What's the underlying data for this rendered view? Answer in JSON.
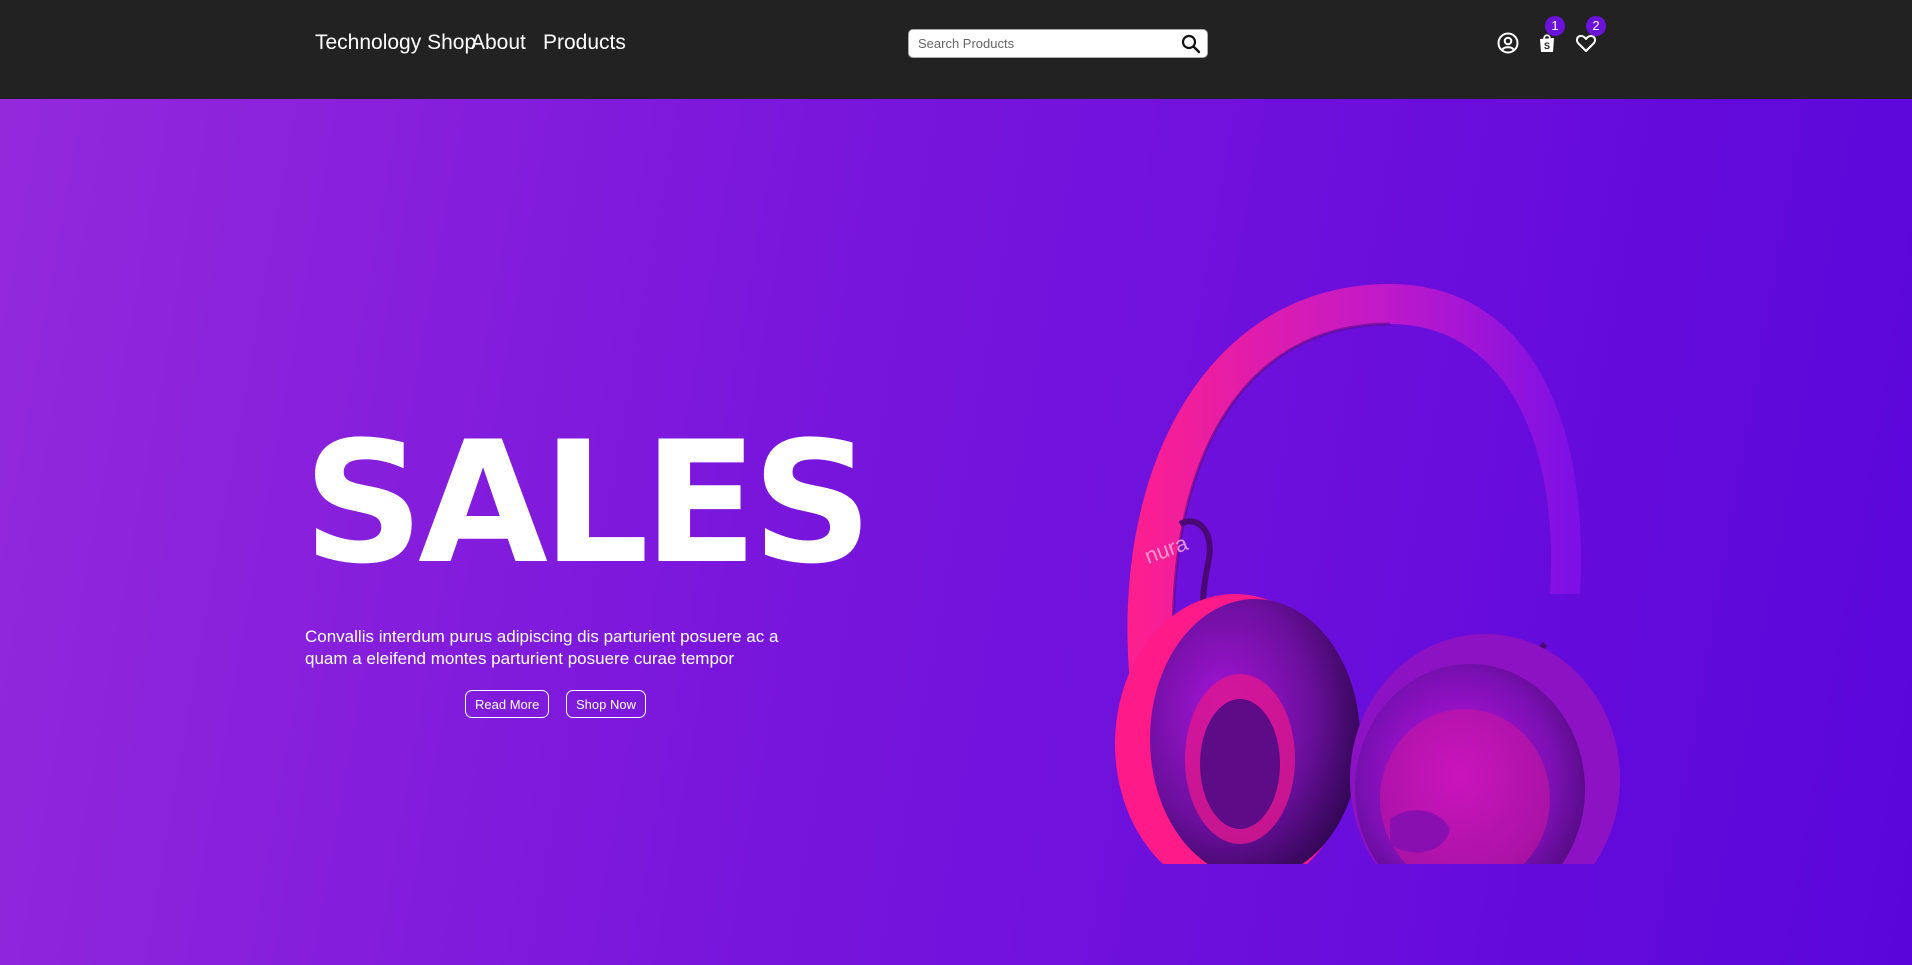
{
  "header": {
    "brand": "Technology Shop",
    "nav": [
      {
        "label": "About"
      },
      {
        "label": "Products"
      }
    ],
    "search": {
      "placeholder": "Search Products",
      "value": "",
      "icon": "search-icon"
    },
    "icons": [
      {
        "name": "user-icon"
      },
      {
        "name": "shopping-bag-icon",
        "badge": "1"
      },
      {
        "name": "heart-icon",
        "badge": "2"
      }
    ],
    "badge_color": "#6b12db"
  },
  "hero": {
    "title": "SALES",
    "description": "Convallis interdum purus adipiscing dis parturient posuere ac a quam a eleifend montes parturient posuere curae tempor",
    "buttons": [
      {
        "label": "Read More"
      },
      {
        "label": "Shop Now"
      }
    ],
    "image_label": "nura",
    "colors": {
      "gradient_start": "#9429dc",
      "gradient_end": "#5a06db",
      "product": "#ff1f8e"
    }
  }
}
